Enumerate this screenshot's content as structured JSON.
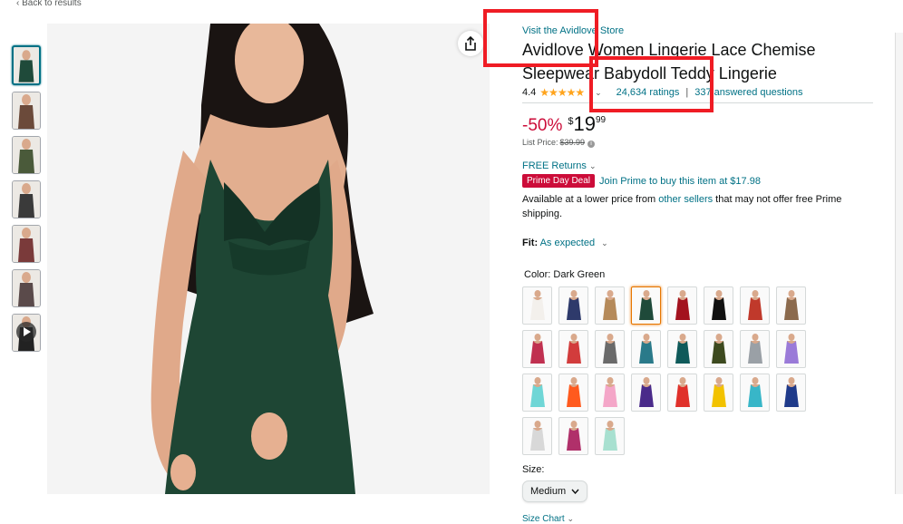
{
  "nav": {
    "back": "Back to results"
  },
  "product": {
    "store": "Visit the Avidlove Store",
    "title": "Avidlove Women Lingerie Lace Chemise Sleepwear Babydoll Teddy Lingerie",
    "rating": "4.4",
    "stars": "★★★★★",
    "ratings_count": "24,634 ratings",
    "answered": "337 answered questions",
    "discount": "-50%",
    "price_symbol": "$",
    "price_whole": "19",
    "price_cents": "99",
    "list_price_label": "List Price:",
    "list_price": "$39.99",
    "returns": "FREE Returns",
    "deal_badge": "Prime Day Deal",
    "prime_text": "Join Prime to buy this item at $17.98",
    "avail_pre": "Available at a lower price from ",
    "avail_link": "other sellers",
    "avail_post": " that may not offer free Prime shipping.",
    "fit_label": "Fit:",
    "fit_value": "As expected",
    "color_label": "Color:",
    "color_value": "Dark Green",
    "size_label": "Size:",
    "size_value": "Medium",
    "size_chart": "Size Chart"
  },
  "swatch_colors": [
    "#f3f0ec",
    "#2e3a6b",
    "#b58a5a",
    "#1f4a3a",
    "#a3121e",
    "#111111",
    "#c0392b",
    "#8b6a4d",
    "#c03050",
    "#d23c3c",
    "#6a6a6a",
    "#2a7a8a",
    "#0f5a5a",
    "#3d4a1f",
    "#9aa0a6",
    "#9a7ad8",
    "#6fd6d6",
    "#ff5a1e",
    "#f4a6c8",
    "#4a2a8a",
    "#e0302a",
    "#f2c200",
    "#38b6c8",
    "#1f3a8a",
    "#d8d8d8",
    "#b0306a",
    "#a8e0d0"
  ],
  "selected_swatch": 3,
  "thumb_colors": [
    "#1f4a3a",
    "#6b4a3a",
    "#4a5a3a",
    "#3a3a3a",
    "#7a3a3a",
    "#5a4a4a",
    "#222222"
  ]
}
